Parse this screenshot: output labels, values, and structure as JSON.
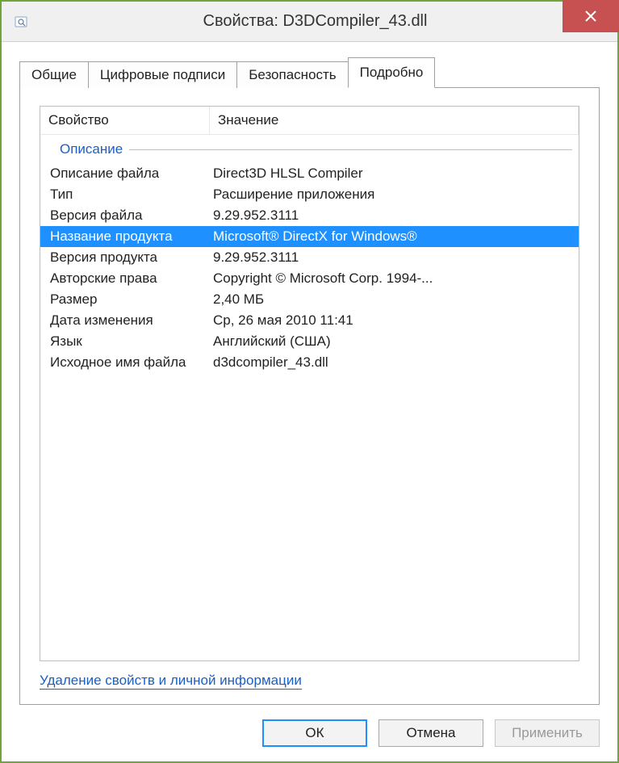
{
  "window": {
    "title": "Свойства: D3DCompiler_43.dll"
  },
  "tabs": {
    "general": "Общие",
    "digital_signatures": "Цифровые подписи",
    "security": "Безопасность",
    "details": "Подробно"
  },
  "list": {
    "headers": {
      "property": "Свойство",
      "value": "Значение"
    },
    "group_label": "Описание",
    "rows": [
      {
        "prop": "Описание файла",
        "val": "Direct3D HLSL Compiler",
        "selected": false
      },
      {
        "prop": "Тип",
        "val": "Расширение приложения",
        "selected": false
      },
      {
        "prop": "Версия файла",
        "val": "9.29.952.3111",
        "selected": false
      },
      {
        "prop": "Название продукта",
        "val": "Microsoft® DirectX for Windows®",
        "selected": true
      },
      {
        "prop": "Версия продукта",
        "val": "9.29.952.3111",
        "selected": false
      },
      {
        "prop": "Авторские права",
        "val": "Copyright © Microsoft Corp. 1994-...",
        "selected": false
      },
      {
        "prop": "Размер",
        "val": "2,40 МБ",
        "selected": false
      },
      {
        "prop": "Дата изменения",
        "val": "Ср, 26 мая 2010 11:41",
        "selected": false
      },
      {
        "prop": "Язык",
        "val": "Английский (США)",
        "selected": false
      },
      {
        "prop": "Исходное имя файла",
        "val": "d3dcompiler_43.dll",
        "selected": false
      }
    ]
  },
  "link": {
    "remove_props": "Удаление свойств и личной информации"
  },
  "buttons": {
    "ok": "ОК",
    "cancel": "Отмена",
    "apply": "Применить"
  }
}
